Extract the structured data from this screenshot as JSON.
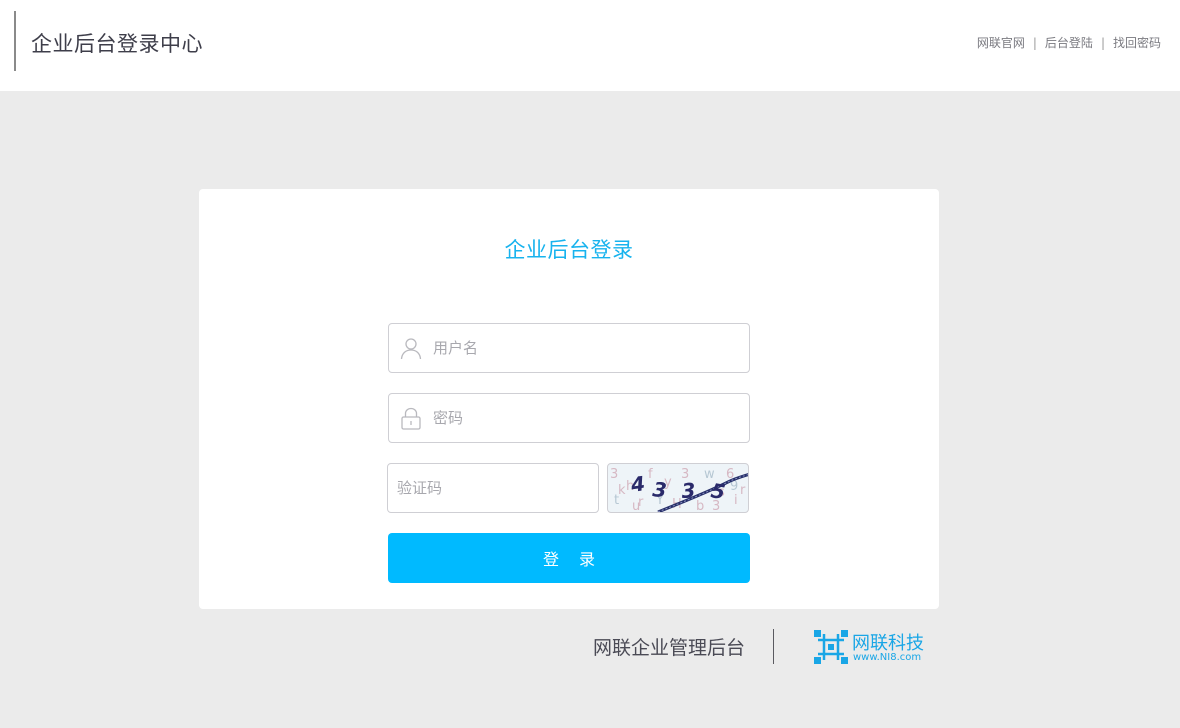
{
  "header": {
    "title": "企业后台登录中心",
    "links": [
      "网联官网",
      "后台登陆",
      "找回密码"
    ],
    "separator": "|"
  },
  "login": {
    "title": "企业后台登录",
    "username_placeholder": "用户名",
    "password_placeholder": "密码",
    "captcha_placeholder": "验证码",
    "captcha_text": "4335",
    "submit_label": "登录"
  },
  "footer": {
    "system_name": "网联企业管理后台",
    "brand_name": "网联科技",
    "brand_url": "www.NI8.com"
  },
  "colors": {
    "accent": "#00baff",
    "title_blue": "#18b3ee",
    "background": "#ebebeb"
  },
  "icons": {
    "username": "user-icon",
    "password": "lock-icon",
    "brand": "grid-logo-icon"
  }
}
